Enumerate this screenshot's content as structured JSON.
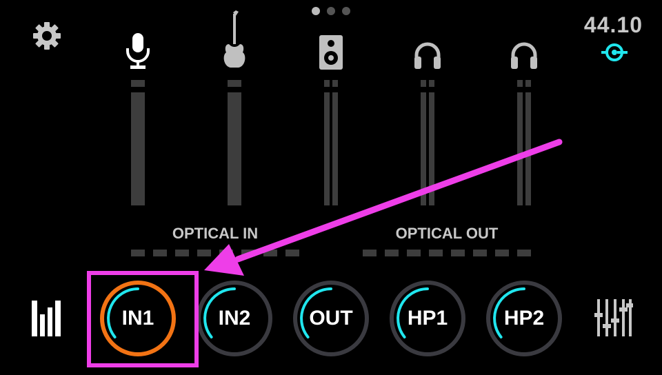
{
  "header": {
    "page_indicator": {
      "count": 3,
      "active_index": 0
    },
    "sample_rate": "44.10",
    "sample_rate_color": "#20e6ee"
  },
  "channels": [
    {
      "name": "mic",
      "icon": "microphone-icon"
    },
    {
      "name": "guitar",
      "icon": "guitar-icon"
    },
    {
      "name": "speaker",
      "icon": "speaker-icon"
    },
    {
      "name": "headphones-1",
      "icon": "headphones-icon"
    },
    {
      "name": "headphones-2",
      "icon": "headphones-icon"
    }
  ],
  "sections": {
    "optical_in": "OPTICAL IN",
    "optical_out": "OPTICAL OUT"
  },
  "knobs": [
    {
      "label": "IN1",
      "selected": true,
      "ring_color": "#f27314"
    },
    {
      "label": "IN2",
      "selected": false,
      "ring_color": "#3a3a40"
    },
    {
      "label": "OUT",
      "selected": false,
      "ring_color": "#3a3a40"
    },
    {
      "label": "HP1",
      "selected": false,
      "ring_color": "#3a3a40"
    },
    {
      "label": "HP2",
      "selected": false,
      "ring_color": "#3a3a40"
    }
  ],
  "colors": {
    "knob_level_arc": "#20e6ee",
    "annotation_highlight": "#ee3ee8",
    "meter_gray": "#3d3d3d"
  },
  "bottom_bar": {
    "left_icon": "level-meters-icon",
    "right_icon": "mixer-faders-icon"
  },
  "top_bar": {
    "settings_icon": "gear-icon",
    "sync_icon": "sync-lock-icon"
  }
}
